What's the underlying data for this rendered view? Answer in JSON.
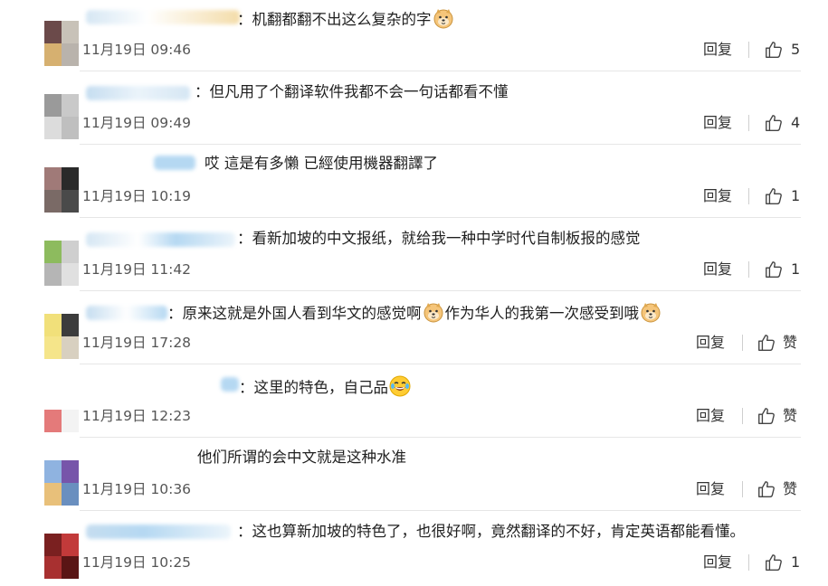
{
  "comments": [
    {
      "text": "：机翻都翻不出这么复杂的字",
      "time": "11月19日 09:46",
      "reply": "回复",
      "likes": "5",
      "emoji_end": "doge-emoji"
    },
    {
      "text": "：但凡用了个翻译软件我都不会一句话都看不懂",
      "time": "11月19日 09:49",
      "reply": "回复",
      "likes": "4"
    },
    {
      "text": "哎 這是有多懶 已經使用機器翻譯了",
      "time": "11月19日 10:19",
      "reply": "回复",
      "likes": "1"
    },
    {
      "text": "：看新加坡的中文报纸，就给我一种中学时代自制板报的感觉",
      "time": "11月19日 11:42",
      "reply": "回复",
      "likes": "1"
    },
    {
      "text_a": "：原来这就是外国人看到华文的感觉啊",
      "text_b": "作为华人的我第一次感受到哦",
      "time": "11月19日 17:28",
      "reply": "回复",
      "likes": "赞"
    },
    {
      "text": "：这里的特色，自己品",
      "time": "11月19日 12:23",
      "reply": "回复",
      "likes": "赞",
      "emoji_end": "laugh-cry-emoji"
    },
    {
      "text": "他们所谓的会中文就是这种水准",
      "time": "11月19日 10:36",
      "reply": "回复",
      "likes": "赞"
    },
    {
      "text": "：这也算新加坡的特色了，也很好啊，竟然翻译的不好，肯定英语都能看懂。",
      "time": "11月19日 10:25",
      "reply": "回复",
      "likes": "1"
    }
  ],
  "colors": {
    "divider": "#e6e6e6",
    "text": "#1f1f1f",
    "meta": "#555555",
    "blur_blue": "#a9d2f0"
  }
}
